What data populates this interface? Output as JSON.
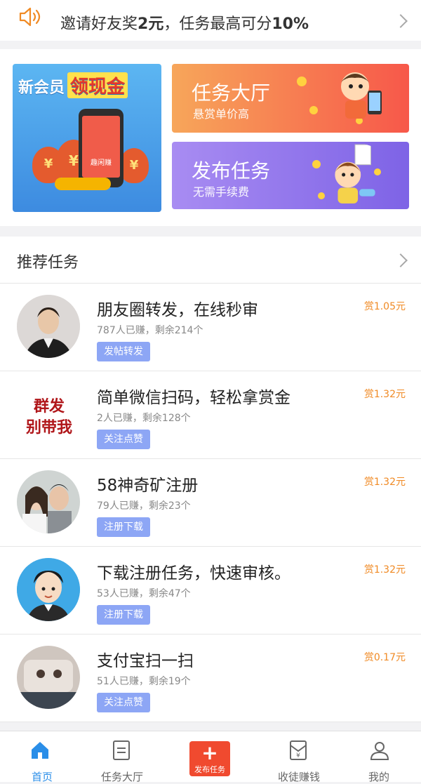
{
  "notice": {
    "text_prefix": "邀请好友奖",
    "amount": "2元",
    "text_mid": "，任务最高可分",
    "percent": "10%"
  },
  "promos": {
    "new_member": {
      "title_main": "新会员",
      "title_highlight": "领现金",
      "phone_label": "趣闲赚"
    },
    "task_hall": {
      "title": "任务大厅",
      "subtitle": "悬赏单价高"
    },
    "publish": {
      "title": "发布任务",
      "subtitle": "无需手续费"
    }
  },
  "section": {
    "label": "推荐任务"
  },
  "tasks": [
    {
      "title": "朋友圈转发，在线秒审",
      "meta": "787人已赚，剩余214个",
      "tag": "发帖转发",
      "reward": "赏1.05元",
      "avatar_text": ""
    },
    {
      "title": "简单微信扫码，轻松拿赏金",
      "meta": "2人已赚，剩余128个",
      "tag": "关注点赞",
      "reward": "赏1.32元",
      "avatar_text": "群发别带我"
    },
    {
      "title": "58神奇矿注册",
      "meta": "79人已赚，剩余23个",
      "tag": "注册下载",
      "reward": "赏1.32元",
      "avatar_text": ""
    },
    {
      "title": "下载注册任务，快速审核。",
      "meta": "53人已赚，剩余47个",
      "tag": "注册下载",
      "reward": "赏1.32元",
      "avatar_text": ""
    },
    {
      "title": "支付宝扫一扫",
      "meta": "51人已赚，剩余19个",
      "tag": "关注点赞",
      "reward": "赏0.17元",
      "avatar_text": ""
    }
  ],
  "tabbar": {
    "home": "首页",
    "hall": "任务大厅",
    "publish": "发布任务",
    "earn": "收徒赚钱",
    "mine": "我的"
  },
  "colors": {
    "accent": "#2a8ee8",
    "reward": "#f08a24",
    "tag": "#8da6f5",
    "publish": "#f04a2f"
  }
}
